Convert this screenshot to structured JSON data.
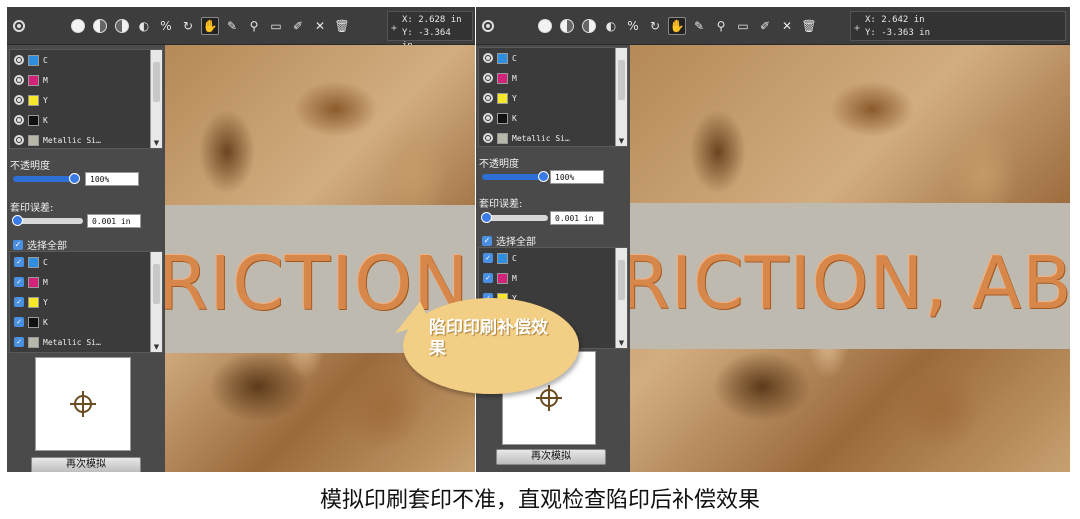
{
  "toolbar": {
    "tools": [
      "full-disc",
      "half-disc",
      "half-disc-alt",
      "moon",
      "zoom-percent",
      "rotate",
      "hand",
      "eyedropper",
      "magnifier",
      "ruler",
      "brush",
      "cross-select",
      "trash"
    ]
  },
  "panels": [
    {
      "coords": {
        "x": "X: 2.628 in",
        "y": "Y: -3.364 in"
      },
      "inks": [
        {
          "name": "C",
          "color": "#2e8fe0"
        },
        {
          "name": "M",
          "color": "#d2237a"
        },
        {
          "name": "Y",
          "color": "#f7e92a"
        },
        {
          "name": "K",
          "color": "#111111"
        },
        {
          "name": "Metallic Si…",
          "color": "#b9b6aa"
        }
      ],
      "opacity_label": "不透明度",
      "opacity_value": "100%",
      "misreg_label": "套印误差:",
      "misreg_value": "0.001 in",
      "select_all": "选择全部",
      "resimulate": "再次模拟",
      "canvas_text": "RICTION"
    },
    {
      "coords": {
        "x": "X: 2.642 in",
        "y": "Y: -3.363 in"
      },
      "inks": [
        {
          "name": "C",
          "color": "#2e8fe0"
        },
        {
          "name": "M",
          "color": "#d2237a"
        },
        {
          "name": "Y",
          "color": "#f7e92a"
        },
        {
          "name": "K",
          "color": "#111111"
        },
        {
          "name": "Metallic Si…",
          "color": "#b9b6aa"
        }
      ],
      "opacity_label": "不透明度",
      "opacity_value": "100%",
      "misreg_label": "套印误差:",
      "misreg_value": "0.001 in",
      "select_all": "选择全部",
      "resimulate": "再次模拟",
      "canvas_text": "RICTION, AB"
    }
  ],
  "callout": "陷印印刷补偿效果",
  "caption": "模拟印刷套印不准，直观检查陷印后补偿效果"
}
